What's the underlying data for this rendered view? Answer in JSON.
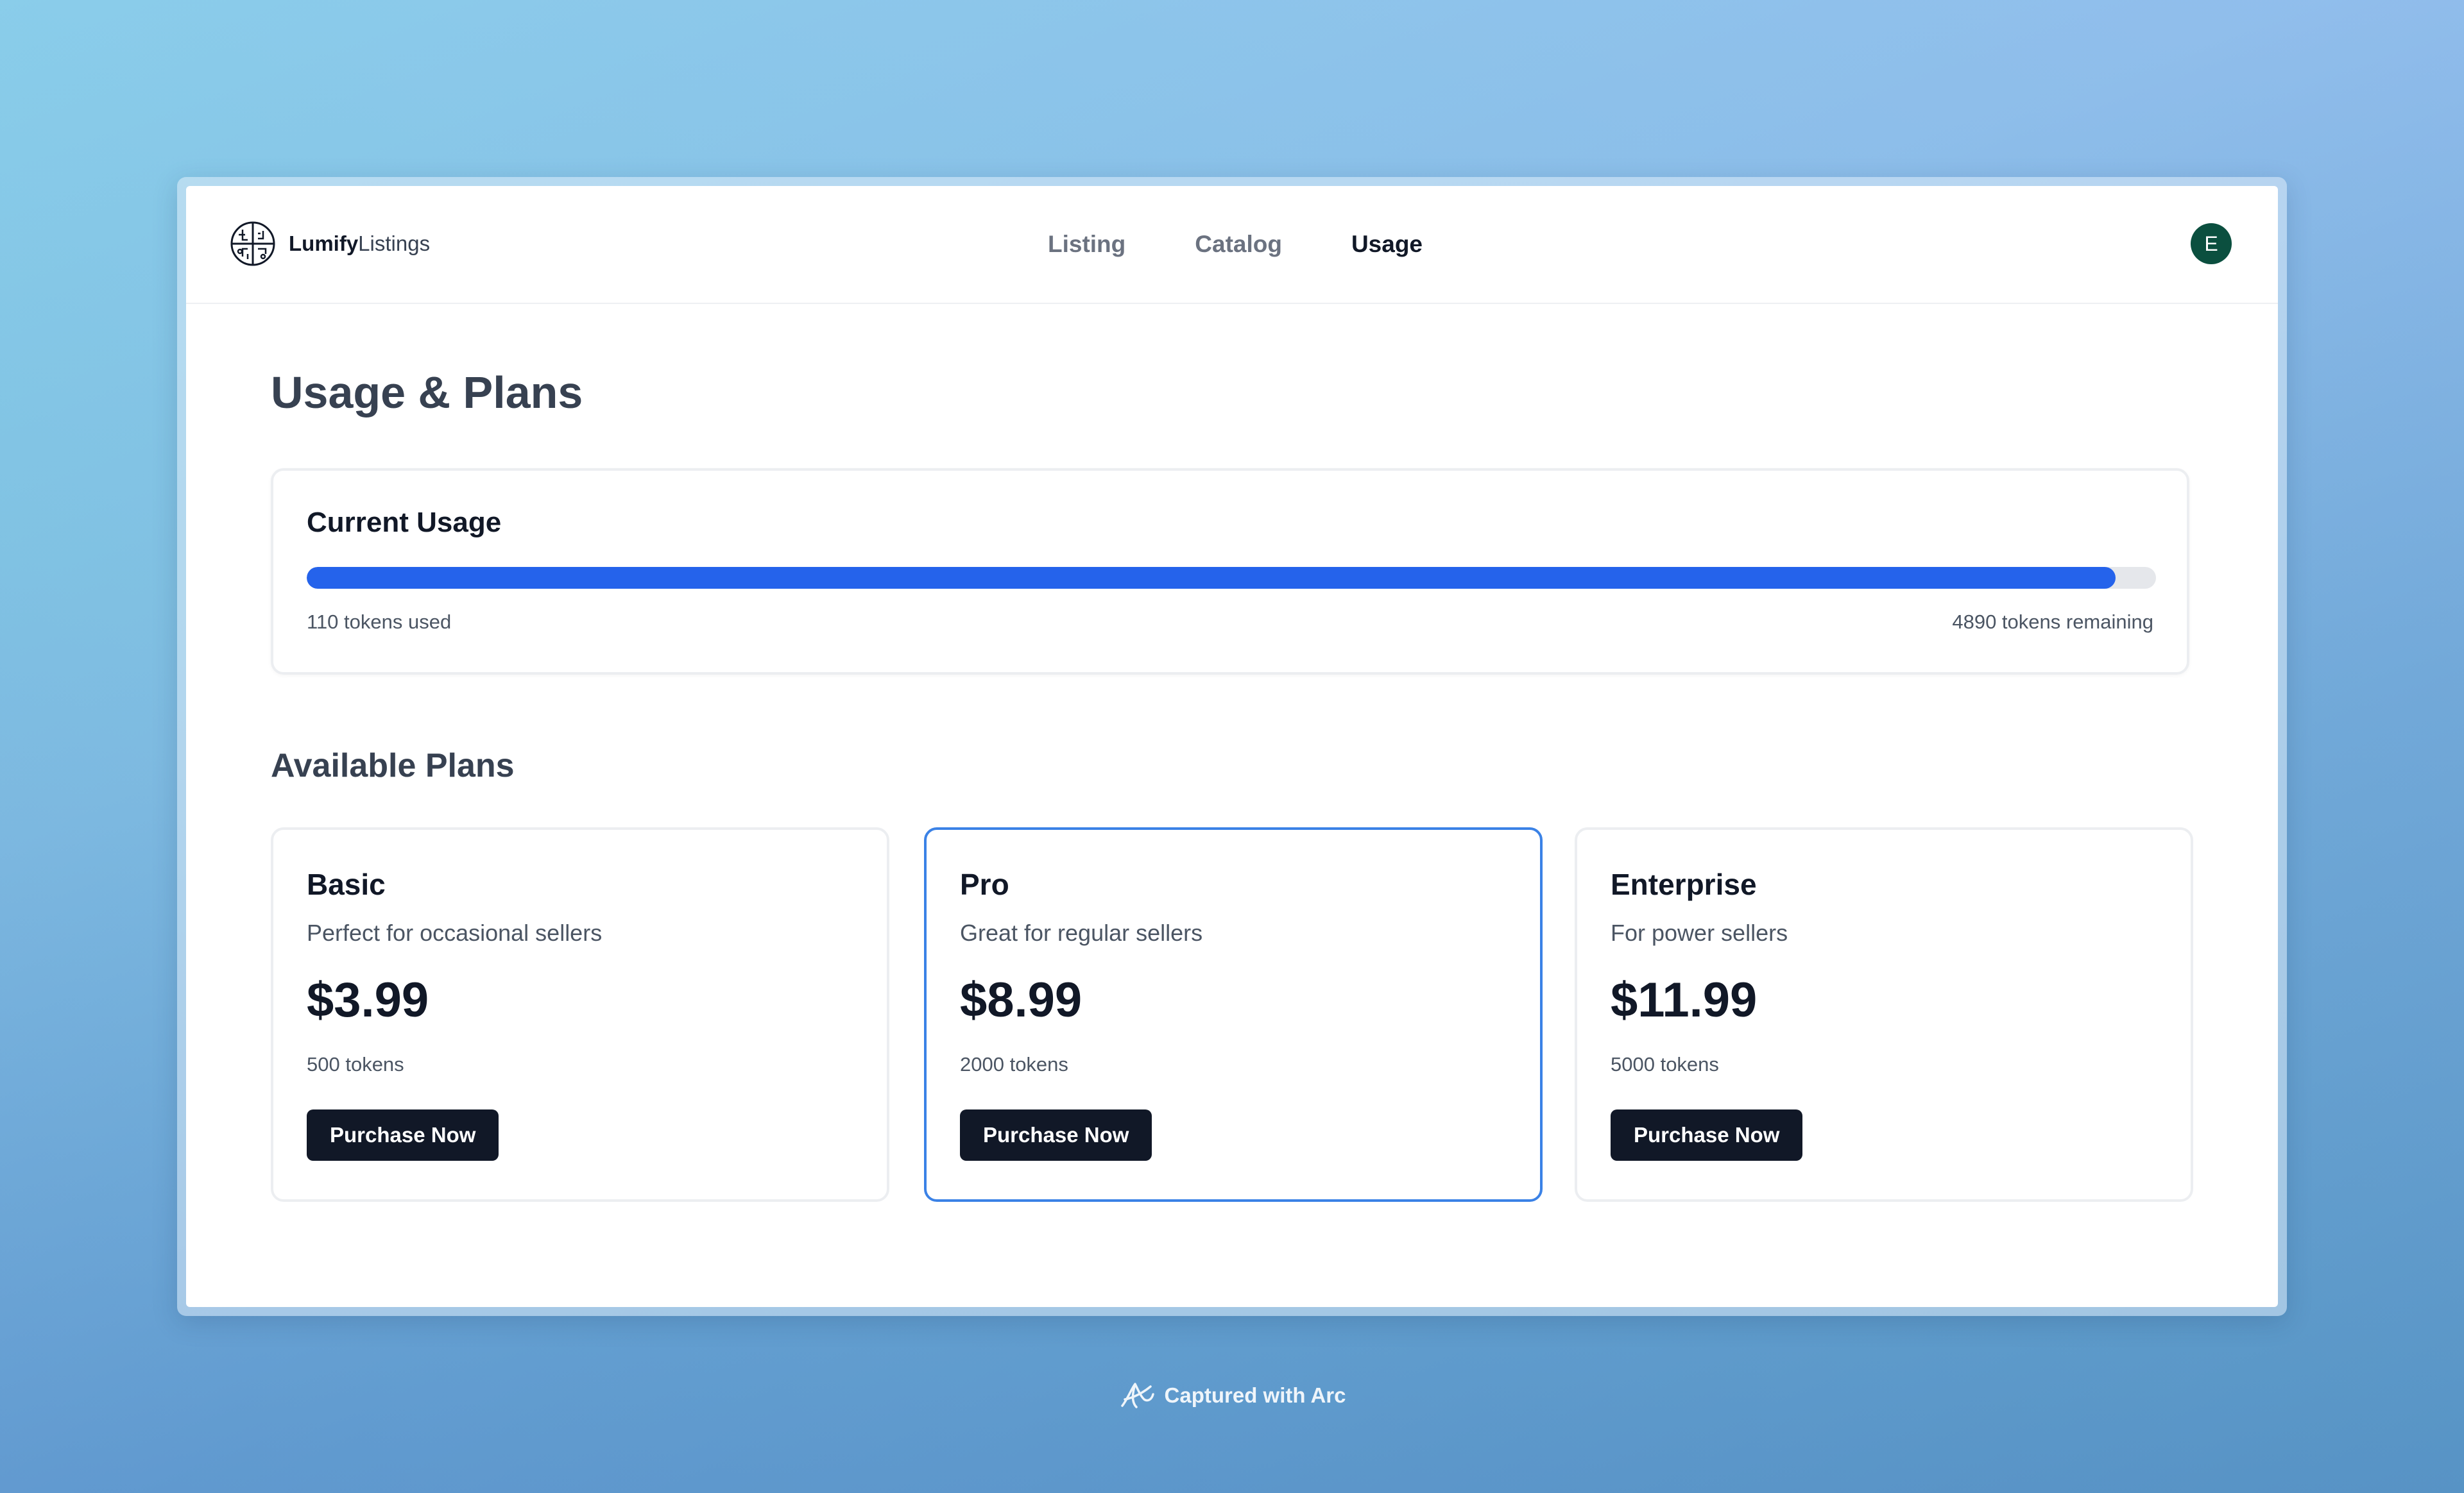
{
  "brand": {
    "name_strong": "Lumify",
    "name_light": "Listings"
  },
  "nav": {
    "items": [
      {
        "label": "Listing",
        "active": false
      },
      {
        "label": "Catalog",
        "active": false
      },
      {
        "label": "Usage",
        "active": true
      }
    ]
  },
  "user": {
    "avatar_initial": "E",
    "avatar_color": "#0b4f3f"
  },
  "page": {
    "title": "Usage & Plans"
  },
  "usage": {
    "title": "Current Usage",
    "used_label": "110 tokens used",
    "remaining_label": "4890 tokens remaining",
    "progress_fraction": 0.978,
    "bar_color": "#2563eb"
  },
  "plans_section": {
    "title": "Available Plans",
    "plans": [
      {
        "name": "Basic",
        "description": "Perfect for occasional sellers",
        "price": "$3.99",
        "tokens": "500 tokens",
        "button_label": "Purchase Now",
        "highlighted": false
      },
      {
        "name": "Pro",
        "description": "Great for regular sellers",
        "price": "$8.99",
        "tokens": "2000 tokens",
        "button_label": "Purchase Now",
        "highlighted": true
      },
      {
        "name": "Enterprise",
        "description": "For power sellers",
        "price": "$11.99",
        "tokens": "5000 tokens",
        "button_label": "Purchase Now",
        "highlighted": false
      }
    ]
  },
  "footer": {
    "caption": "Captured with Arc",
    "icon": "arc-logo-icon"
  },
  "colors": {
    "accent": "#2563eb",
    "highlight_border": "#3b82e6",
    "button_bg": "#111827"
  }
}
